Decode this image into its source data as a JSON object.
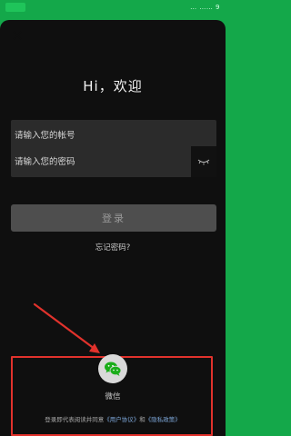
{
  "status_bar": {
    "right_text": "… …… 9"
  },
  "login": {
    "greeting": "Hi，欢迎",
    "account_placeholder": "请输入您的帐号",
    "password_placeholder": "请输入您的密码",
    "login_label": "登录",
    "forgot_label": "忘记密码?"
  },
  "third_party": {
    "wechat_label": "微信",
    "agreement_prefix": "登录即代表阅读并同意",
    "user_agreement": "《用户协议》",
    "and_text": "和",
    "privacy_policy": "《隐私政策》"
  },
  "icons": {
    "close": "close-icon",
    "eye": "eye-closed-icon",
    "wechat": "wechat-icon"
  },
  "colors": {
    "brand_green": "#14a84a",
    "sheet_bg": "#0f0f0f",
    "annotation_red": "#e1322c",
    "link_blue": "#7da7d9"
  }
}
